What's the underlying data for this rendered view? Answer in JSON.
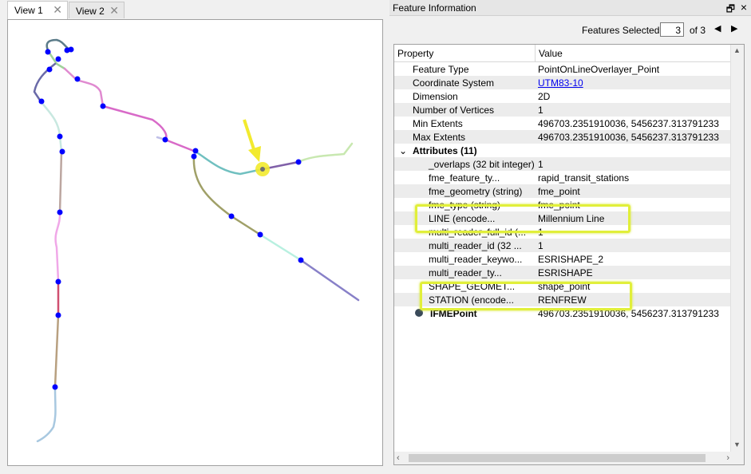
{
  "tabs": [
    {
      "label": "View 1"
    },
    {
      "label": "View 2"
    }
  ],
  "panel": {
    "title": "Feature Information"
  },
  "selection": {
    "label": "Features Selected:",
    "value": "3",
    "of": "of 3"
  },
  "table": {
    "headers": {
      "property": "Property",
      "value": "Value"
    },
    "rows": [
      {
        "p": "Feature Type",
        "v": "PointOnLineOverlayer_Point"
      },
      {
        "p": "Coordinate System",
        "v": "UTM83-10"
      },
      {
        "p": "Dimension",
        "v": "2D"
      },
      {
        "p": "Number of Vertices",
        "v": "1"
      },
      {
        "p": "Min Extents",
        "v": "496703.2351910036, 5456237.313791233"
      },
      {
        "p": "Max Extents",
        "v": "496703.2351910036, 5456237.313791233"
      },
      {
        "p": "Attributes (11)",
        "v": ""
      },
      {
        "p": "_overlaps (32 bit integer)",
        "v": "1"
      },
      {
        "p": "fme_feature_ty...",
        "v": "rapid_transit_stations"
      },
      {
        "p": "fme_geometry (string)",
        "v": "fme_point"
      },
      {
        "p": "fme_type (string)",
        "v": "fme_point"
      },
      {
        "p": "LINE (encode...",
        "v": "Millennium Line"
      },
      {
        "p": "multi_reader_full_id (...",
        "v": "1"
      },
      {
        "p": "multi_reader_id (32 ...",
        "v": "1"
      },
      {
        "p": "multi_reader_keywo...",
        "v": "ESRISHAPE_2"
      },
      {
        "p": "multi_reader_ty...",
        "v": "ESRISHAPE"
      },
      {
        "p": "SHAPE_GEOMET...",
        "v": "shape_point"
      },
      {
        "p": "STATION (encode...",
        "v": "RENFREW"
      },
      {
        "p": "IFMEPoint",
        "v": "496703.2351910036, 5456237.313791233"
      }
    ]
  },
  "colors": {
    "highlight": "#e1ef3a",
    "arrow": "#f2ea2e",
    "station": "#0000ff"
  }
}
